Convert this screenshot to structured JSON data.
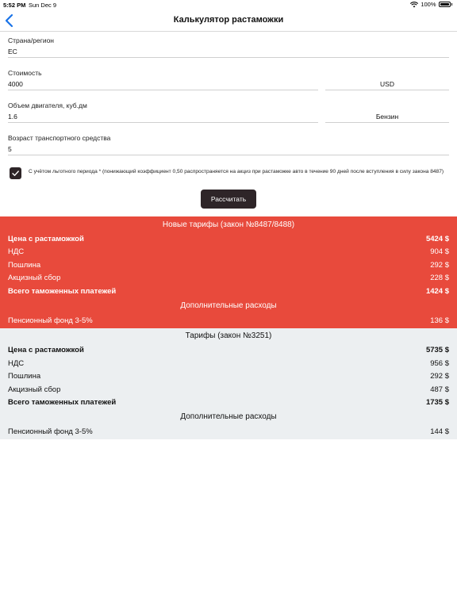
{
  "status_bar": {
    "time": "5:52 PM",
    "date": "Sun Dec 9",
    "battery": "100%"
  },
  "nav": {
    "title": "Калькулятор растаможки"
  },
  "form": {
    "country": {
      "label": "Страна/регион",
      "value": "ЕС"
    },
    "cost": {
      "label": "Стоимость",
      "value": "4000",
      "currency": "USD"
    },
    "engine": {
      "label": "Объем двигателя, куб.дм",
      "value": "1.6",
      "fuel": "Бензин"
    },
    "age": {
      "label": "Возраст транспортного средства",
      "value": "5"
    },
    "preferential": {
      "checked": true,
      "text": "С учётом льготного периода * (понижающий коэффициент 0,50 распространяется на акциз при растаможке авто в течение 90 дней после вступления в силу закона 8487)"
    },
    "calculate_label": "Рассчитать"
  },
  "new_tariffs": {
    "title": "Новые тарифы (закон №8487/8488)",
    "rows": [
      {
        "label": "Цена с растаможкой",
        "value": "5424 $"
      },
      {
        "label": "НДС",
        "value": "904 $"
      },
      {
        "label": "Пошлина",
        "value": "292 $"
      },
      {
        "label": "Акцизный сбор",
        "value": "228 $"
      },
      {
        "label": "Всего таможенных платежей",
        "value": "1424 $"
      }
    ],
    "extra_title": "Дополнительные расходы",
    "extra_rows": [
      {
        "label": "Пенсионный фонд 3-5%",
        "value": "136 $"
      }
    ]
  },
  "old_tariffs": {
    "title": "Тарифы (закон №3251)",
    "rows": [
      {
        "label": "Цена с растаможкой",
        "value": "5735 $"
      },
      {
        "label": "НДС",
        "value": "956 $"
      },
      {
        "label": "Пошлина",
        "value": "292 $"
      },
      {
        "label": "Акцизный сбор",
        "value": "487 $"
      },
      {
        "label": "Всего таможенных платежей",
        "value": "1735 $"
      }
    ],
    "extra_title": "Дополнительные расходы",
    "extra_rows": [
      {
        "label": "Пенсионный фонд 3-5%",
        "value": "144 $"
      }
    ]
  },
  "colors": {
    "accent_red": "#e84a3c",
    "dark_button": "#2e2528",
    "result_grey": "#eceff1",
    "back_blue": "#1a73e8"
  }
}
